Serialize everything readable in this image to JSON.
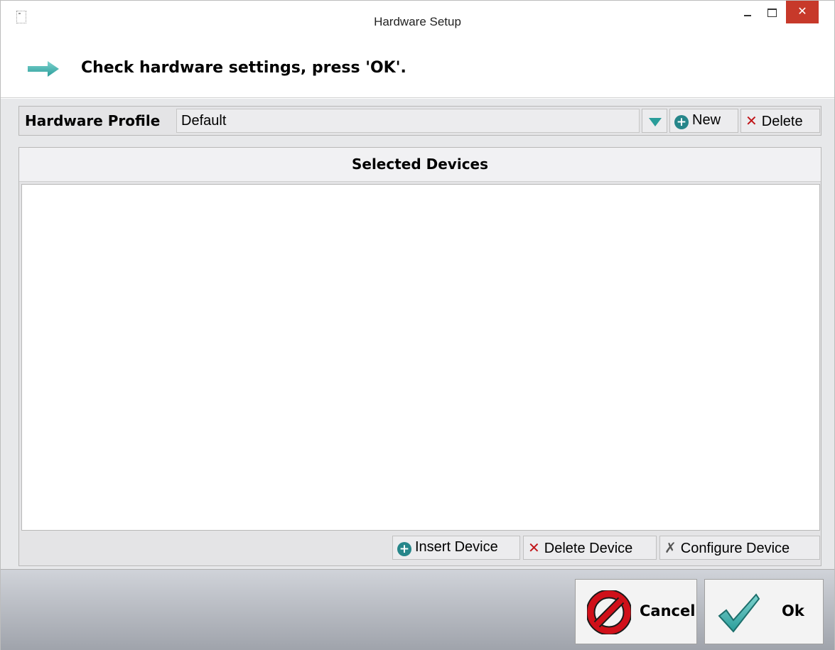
{
  "window": {
    "title": "Hardware Setup",
    "close_glyph": "✕"
  },
  "instruction": {
    "text": "Check hardware settings, press 'OK'.",
    "icon": "arrow-right-icon"
  },
  "profile": {
    "label": "Hardware Profile",
    "value": "Default",
    "new_label": "New",
    "delete_label": "Delete"
  },
  "devices": {
    "header": "Selected Devices",
    "items": [],
    "insert_label": "Insert Device",
    "delete_label": "Delete Device",
    "configure_label": "Configure Device"
  },
  "footer": {
    "cancel_label": "Cancel",
    "ok_label": "Ok"
  },
  "colors": {
    "accent_teal": "#2a9d9a",
    "delete_red": "#c01418",
    "close_red": "#c7392a"
  }
}
